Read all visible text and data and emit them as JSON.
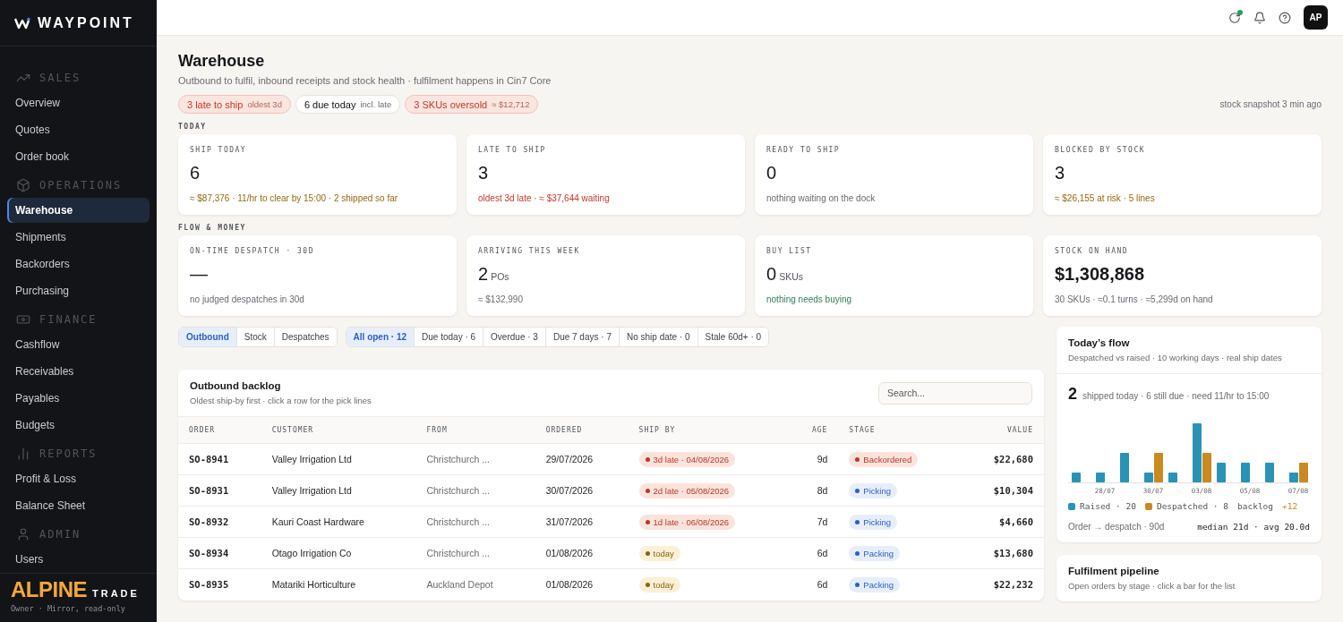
{
  "brand": {
    "name": "WAYPOINT"
  },
  "sidebar": {
    "sections": [
      {
        "title": "SALES",
        "items": [
          {
            "label": "Overview",
            "selected": false
          },
          {
            "label": "Quotes",
            "selected": false
          },
          {
            "label": "Order book",
            "selected": false
          }
        ]
      },
      {
        "title": "OPERATIONS",
        "items": [
          {
            "label": "Warehouse",
            "selected": true
          },
          {
            "label": "Shipments",
            "selected": false
          },
          {
            "label": "Backorders",
            "selected": false
          },
          {
            "label": "Purchasing",
            "selected": false
          }
        ]
      },
      {
        "title": "FINANCE",
        "items": [
          {
            "label": "Cashflow",
            "selected": false
          },
          {
            "label": "Receivables",
            "selected": false
          },
          {
            "label": "Payables",
            "selected": false
          },
          {
            "label": "Budgets",
            "selected": false
          }
        ]
      },
      {
        "title": "REPORTS",
        "items": [
          {
            "label": "Profit & Loss",
            "selected": false
          },
          {
            "label": "Balance Sheet",
            "selected": false
          }
        ]
      },
      {
        "title": "ADMIN",
        "items": [
          {
            "label": "Users",
            "selected": false
          }
        ]
      }
    ]
  },
  "tenant": {
    "name": "ALPINE",
    "suffix": "TRADE",
    "role": "Owner · Mirror, read-only"
  },
  "topbar": {
    "avatar": "AP"
  },
  "page": {
    "title": "Warehouse",
    "subtitle": "Outbound to fulfil, inbound receipts and stock health · fulfilment happens in Cin7 Core"
  },
  "alerts": [
    {
      "label": "3 late to ship",
      "detail": "oldest 3d",
      "kind": "bad"
    },
    {
      "label": "6 due today",
      "detail": "incl. late",
      "kind": "neutral"
    },
    {
      "label": "3 SKUs oversold",
      "detail": "≈ $12,712",
      "kind": "bad"
    }
  ],
  "snapshot": "stock snapshot 3 min ago",
  "kpi_groups": [
    {
      "title": "TODAY",
      "cards": [
        {
          "label": "SHIP TODAY",
          "value": "6",
          "note": "≈ $87,376 · 11/hr to clear by 15:00 · 2 shipped so far",
          "kind": "warn"
        },
        {
          "label": "LATE TO SHIP",
          "value": "3",
          "note": "oldest 3d late · ≈ $37,644 waiting",
          "kind": "bad"
        },
        {
          "label": "READY TO SHIP",
          "value": "0",
          "note": "nothing waiting on the dock",
          "kind": "muted"
        },
        {
          "label": "BLOCKED BY STOCK",
          "value": "3",
          "note": "≈ $26,155 at risk · 5 lines",
          "kind": "warn"
        }
      ]
    },
    {
      "title": "FLOW & MONEY",
      "cards": [
        {
          "label": "ON-TIME DESPATCH · 30D",
          "value": "—",
          "note": "no judged despatches in 30d",
          "kind": "muted"
        },
        {
          "label": "ARRIVING THIS WEEK",
          "value": "2",
          "unit": "POs",
          "note": "≈ $132,990",
          "kind": "muted"
        },
        {
          "label": "BUY LIST",
          "value": "0",
          "unit": "SKUs",
          "note": "nothing needs buying",
          "kind": "good"
        },
        {
          "label": "STOCK ON HAND",
          "value": "$1,308,868",
          "note": "30 SKUs · ≈0.1 turns · ≈5,299d on hand",
          "kind": "muted"
        }
      ]
    }
  ],
  "view_tabs": [
    {
      "label": "Outbound",
      "selected": true
    },
    {
      "label": "Stock",
      "selected": false
    },
    {
      "label": "Despatches",
      "selected": false
    }
  ],
  "filters": [
    {
      "label": "All open · 12",
      "selected": true
    },
    {
      "label": "Due today · 6",
      "selected": false
    },
    {
      "label": "Overdue · 3",
      "selected": false
    },
    {
      "label": "Due 7 days · 7",
      "selected": false
    },
    {
      "label": "No ship date · 0",
      "selected": false
    },
    {
      "label": "Stale 60d+ · 0",
      "selected": false
    }
  ],
  "backlog": {
    "title": "Outbound backlog",
    "subtitle": "Oldest ship-by first · click a row for the pick lines",
    "search_placeholder": "Search...",
    "columns": [
      "ORDER",
      "CUSTOMER",
      "FROM",
      "ORDERED",
      "SHIP BY",
      "AGE",
      "STAGE",
      "VALUE"
    ],
    "rows": [
      {
        "order": "SO-8941",
        "customer": "Valley Irrigation Ltd",
        "from": "Christchurch ...",
        "ordered": "29/07/2026",
        "ship_by": {
          "text": "3d late · 04/08/2026",
          "kind": "late"
        },
        "age": "9d",
        "stage": {
          "text": "Backordered",
          "kind": "bad"
        },
        "value": "$22,680"
      },
      {
        "order": "SO-8931",
        "customer": "Valley Irrigation Ltd",
        "from": "Christchurch ...",
        "ordered": "30/07/2026",
        "ship_by": {
          "text": "2d late · 05/08/2026",
          "kind": "late"
        },
        "age": "8d",
        "stage": {
          "text": "Picking",
          "kind": "info"
        },
        "value": "$10,304"
      },
      {
        "order": "SO-8932",
        "customer": "Kauri Coast Hardware",
        "from": "Christchurch ...",
        "ordered": "31/07/2026",
        "ship_by": {
          "text": "1d late · 06/08/2026",
          "kind": "late"
        },
        "age": "7d",
        "stage": {
          "text": "Picking",
          "kind": "info"
        },
        "value": "$4,660"
      },
      {
        "order": "SO-8934",
        "customer": "Otago Irrigation Co",
        "from": "Christchurch ...",
        "ordered": "01/08/2026",
        "ship_by": {
          "text": "today",
          "kind": "today"
        },
        "age": "6d",
        "stage": {
          "text": "Packing",
          "kind": "info"
        },
        "value": "$13,680"
      },
      {
        "order": "SO-8935",
        "customer": "Matariki Horticulture",
        "from": "Auckland Depot",
        "ordered": "01/08/2026",
        "ship_by": {
          "text": "today",
          "kind": "today"
        },
        "age": "6d",
        "stage": {
          "text": "Packing",
          "kind": "info"
        },
        "value": "$22,232"
      }
    ]
  },
  "flow": {
    "title": "Today’s flow",
    "subtitle": "Despatched vs raised · 10 working days · real ship dates",
    "shipped": "2",
    "shipped_note": "shipped today · 6 still due · need 11/hr to 15:00",
    "x_labels": [
      "28/07",
      "30/07",
      "03/08",
      "05/08",
      "07/08"
    ],
    "legend": [
      {
        "label": "Raised · 20",
        "color": "#2a93b5"
      },
      {
        "label": "Despatched · 8",
        "color": "#c98a22"
      }
    ],
    "backlog_label": "backlog",
    "backlog_value": "+12",
    "lead_label": "Order → despatch · 90d",
    "lead_stats": "median 21d · avg 20.0d"
  },
  "pipeline": {
    "title": "Fulfilment pipeline",
    "subtitle": "Open orders by stage · click a bar for the list"
  }
}
